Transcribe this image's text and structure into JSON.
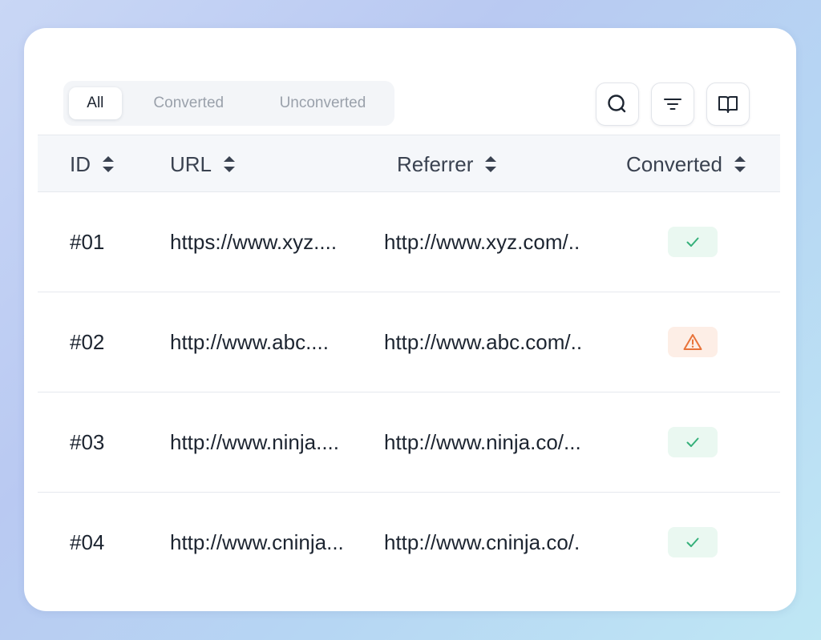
{
  "tabs": [
    {
      "label": "All",
      "active": true
    },
    {
      "label": "Converted",
      "active": false
    },
    {
      "label": "Unconverted",
      "active": false
    }
  ],
  "toolbar": {
    "search_icon": "search-icon",
    "filter_icon": "filter-icon",
    "columns_icon": "book-open-icon"
  },
  "table": {
    "headers": {
      "id": "ID",
      "url": "URL",
      "referrer": "Referrer",
      "converted": "Converted"
    },
    "rows": [
      {
        "id": "#01",
        "url": "https://www.xyz....",
        "referrer": "http://www.xyz.com/..",
        "status": "check"
      },
      {
        "id": "#02",
        "url": "http://www.abc....",
        "referrer": "http://www.abc.com/..",
        "status": "warning"
      },
      {
        "id": "#03",
        "url": "http://www.ninja....",
        "referrer": "http://www.ninja.co/...",
        "status": "check"
      },
      {
        "id": "#04",
        "url": "http://www.cninja...",
        "referrer": "http://www.cninja.co/.",
        "status": "check"
      }
    ]
  },
  "colors": {
    "success": "#35b07a",
    "success_bg": "#eaf8f1",
    "warning": "#e8733a",
    "warning_bg": "#fdeee6"
  }
}
